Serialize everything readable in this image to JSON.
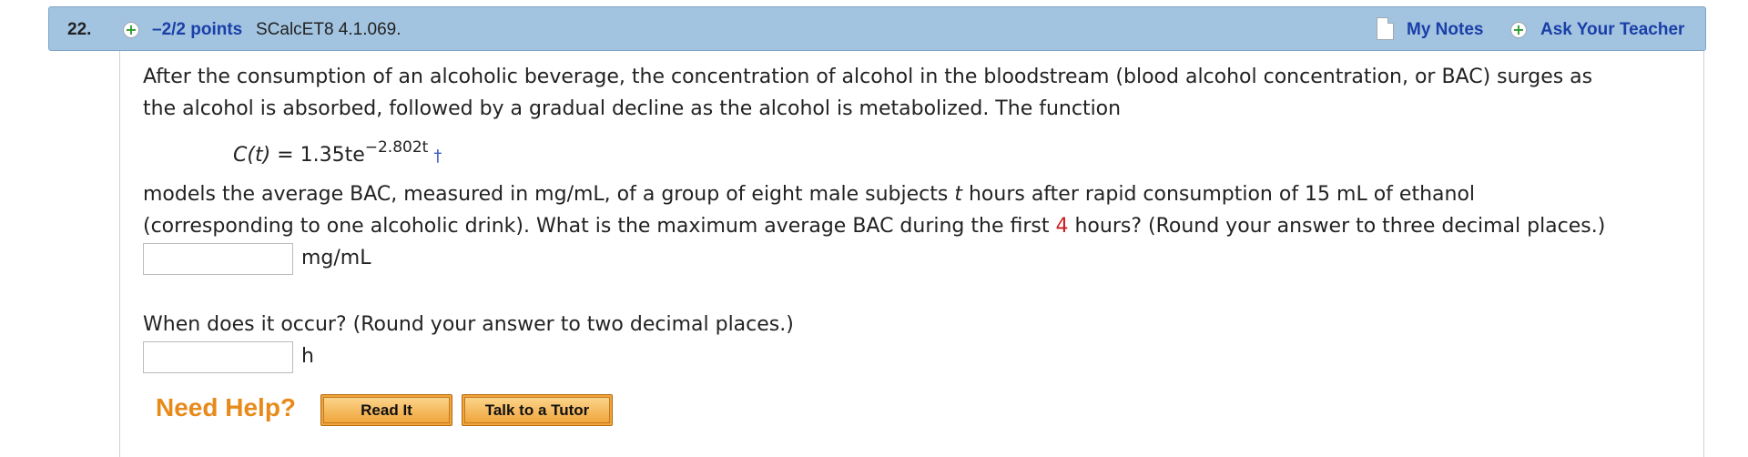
{
  "header": {
    "number": "22.",
    "points": "–2/2 points",
    "source": "SCalcET8 4.1.069.",
    "my_notes": "My Notes",
    "ask_teacher": "Ask Your Teacher",
    "icons": [
      "plus-circle-icon",
      "note-icon",
      "plus-circle-icon"
    ],
    "colors": {
      "header_bg": "#a3c4e0",
      "link": "#1a3fa8",
      "plus": "#2f9a2f"
    }
  },
  "body": {
    "intro_line1": "After the consumption of an alcoholic beverage, the concentration of alcohol in the bloodstream (blood alcohol concentration, or BAC) surges as",
    "intro_line2": "the alcohol is absorbed, followed by a gradual decline as the alcohol is metabolized. The function",
    "formula": {
      "lhs": "C(t)",
      "equals": " = ",
      "coef": "1.35te",
      "exponent": "−2.802t",
      "dagger": "†"
    },
    "models_line1_a": "models the average BAC, measured in mg/mL, of a group of eight male subjects ",
    "models_line1_t": "t",
    "models_line1_b": " hours after rapid consumption of 15 mL of ethanol",
    "models_line2_a": "(corresponding to one alcoholic drink). What is the maximum average BAC during the first ",
    "models_line2_num": "4",
    "models_line2_b": " hours? (Round your answer to three decimal places.)",
    "answer1": {
      "value": "",
      "unit": "mg/mL"
    },
    "question2": "When does it occur? (Round your answer to two decimal places.)",
    "answer2": {
      "value": "",
      "unit": "h"
    }
  },
  "help": {
    "label": "Need Help?",
    "read_it": "Read It",
    "talk_tutor": "Talk to a Tutor",
    "colors": {
      "label": "#e88a1a",
      "button": "#f3a43a"
    }
  }
}
